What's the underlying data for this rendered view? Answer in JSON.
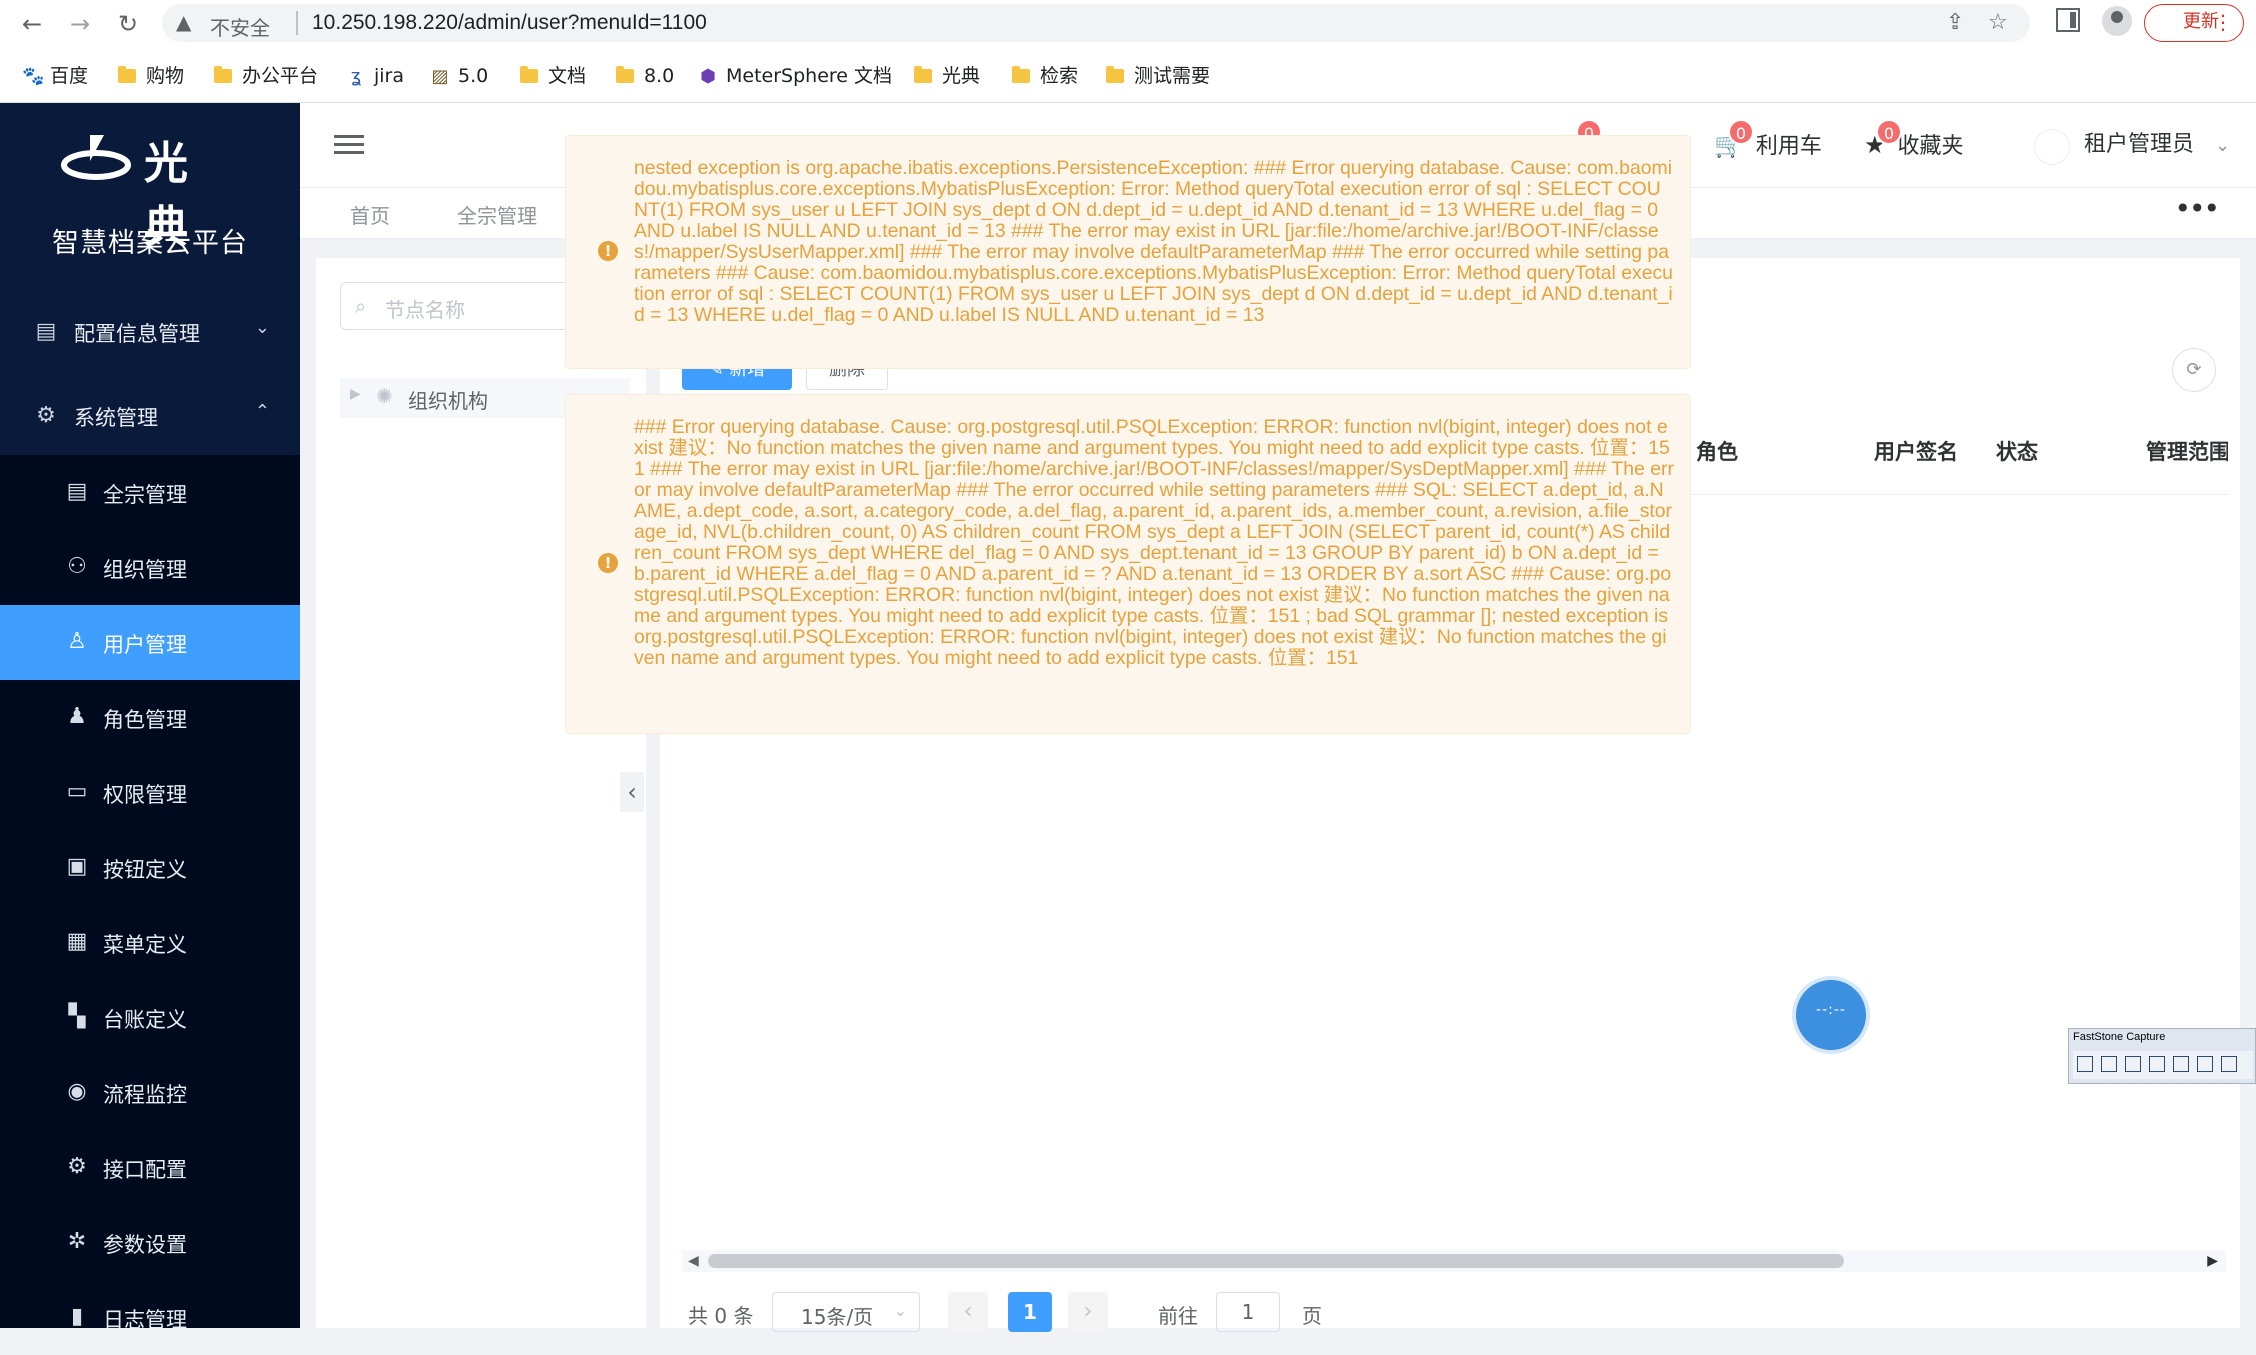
{
  "browser": {
    "security_label": "不安全",
    "url": "10.250.198.220/admin/user?menuId=1100",
    "update_label": "更新",
    "bookmarks": [
      "百度",
      "购物",
      "办公平台",
      "jira",
      "5.0",
      "文档",
      "8.0",
      "MeterSphere 文档",
      "光典",
      "检索",
      "测试需要"
    ],
    "fs_title": "FastStone Capture"
  },
  "sidebar": {
    "logo_text": "光典",
    "platform_title": "智慧档案云平台",
    "groups": [
      {
        "label": "配置信息管理",
        "icon": "clipboard-icon"
      },
      {
        "label": "系统管理",
        "icon": "gear-icon"
      }
    ],
    "items": [
      {
        "label": "全宗管理",
        "icon": "document-icon"
      },
      {
        "label": "组织管理",
        "icon": "org-tree-icon"
      },
      {
        "label": "用户管理",
        "icon": "user-icon"
      },
      {
        "label": "角色管理",
        "icon": "person-icon"
      },
      {
        "label": "权限管理",
        "icon": "folder-icon"
      },
      {
        "label": "按钮定义",
        "icon": "button-icon"
      },
      {
        "label": "菜单定义",
        "icon": "grid-icon"
      },
      {
        "label": "台账定义",
        "icon": "tiles-icon"
      },
      {
        "label": "流程监控",
        "icon": "eye-icon"
      },
      {
        "label": "接口配置",
        "icon": "cog-icon"
      },
      {
        "label": "参数设置",
        "icon": "settings-icon"
      },
      {
        "label": "日志管理",
        "icon": "bar-chart-icon"
      }
    ],
    "active_index": 2
  },
  "header": {
    "badge_first": "0",
    "cart_label": "利用车",
    "cart_badge": "0",
    "favorites_label": "收藏夹",
    "favorites_badge": "0",
    "tenant_label": "租户管理员"
  },
  "tabs": [
    {
      "label": "首页"
    },
    {
      "label": "全宗管理"
    }
  ],
  "tree": {
    "search_placeholder": "节点名称",
    "root_label": "组织机构"
  },
  "table": {
    "add_label": "新增",
    "other_label": "删除",
    "columns": [
      "角色",
      "用户签名",
      "状态",
      "管理范围"
    ]
  },
  "pager": {
    "total": "共 0 条",
    "page_size": "15条/页",
    "current_page": "1",
    "goto_label": "前往",
    "goto_value": "1",
    "page_unit": "页"
  },
  "errors": [
    "nested exception is org.apache.ibatis.exceptions.PersistenceException: ### Error querying database. Cause: com.baomidou.mybatisplus.core.exceptions.MybatisPlusException: Error: Method queryTotal execution error of sql : SELECT COUNT(1) FROM sys_user u LEFT JOIN sys_dept d ON d.dept_id = u.dept_id AND d.tenant_id = 13 WHERE u.del_flag = 0 AND u.label IS NULL AND u.tenant_id = 13 ### The error may exist in URL [jar:file:/home/archive.jar!/BOOT-INF/classes!/mapper/SysUserMapper.xml] ### The error may involve defaultParameterMap ### The error occurred while setting parameters ### Cause: com.baomidou.mybatisplus.core.exceptions.MybatisPlusException: Error: Method queryTotal execution error of sql : SELECT COUNT(1) FROM sys_user u LEFT JOIN sys_dept d ON d.dept_id = u.dept_id AND d.tenant_id = 13 WHERE u.del_flag = 0 AND u.label IS NULL AND u.tenant_id = 13",
    "### Error querying database. Cause: org.postgresql.util.PSQLException: ERROR: function nvl(bigint, integer) does not exist 建议：No function matches the given name and argument types. You might need to add explicit type casts. 位置：151 ### The error may exist in URL [jar:file:/home/archive.jar!/BOOT-INF/classes!/mapper/SysDeptMapper.xml] ### The error may involve defaultParameterMap ### The error occurred while setting parameters ### SQL: SELECT a.dept_id, a.NAME, a.dept_code, a.sort, a.category_code, a.del_flag, a.parent_id, a.parent_ids, a.member_count, a.revision, a.file_storage_id, NVL(b.children_count, 0) AS children_count FROM sys_dept a LEFT JOIN (SELECT parent_id, count(*) AS children_count FROM sys_dept WHERE del_flag = 0 AND sys_dept.tenant_id = 13 GROUP BY parent_id) b ON a.dept_id = b.parent_id WHERE a.del_flag = 0 AND a.parent_id = ? AND a.tenant_id = 13 ORDER BY a.sort ASC ### Cause: org.postgresql.util.PSQLException: ERROR: function nvl(bigint, integer) does not exist 建议：No function matches the given name and argument types. You might need to add explicit type casts. 位置：151 ; bad SQL grammar []; nested exception is org.postgresql.util.PSQLException: ERROR: function nvl(bigint, integer) does not exist 建议：No function matches the given name and argument types. You might need to add explicit type casts. 位置：151"
  ],
  "float_clock": "--:--",
  "colors": {
    "primary": "#409eff",
    "sidebar": "#0a1a3a",
    "warning": "#e6a23c",
    "danger": "#f56c6c"
  }
}
